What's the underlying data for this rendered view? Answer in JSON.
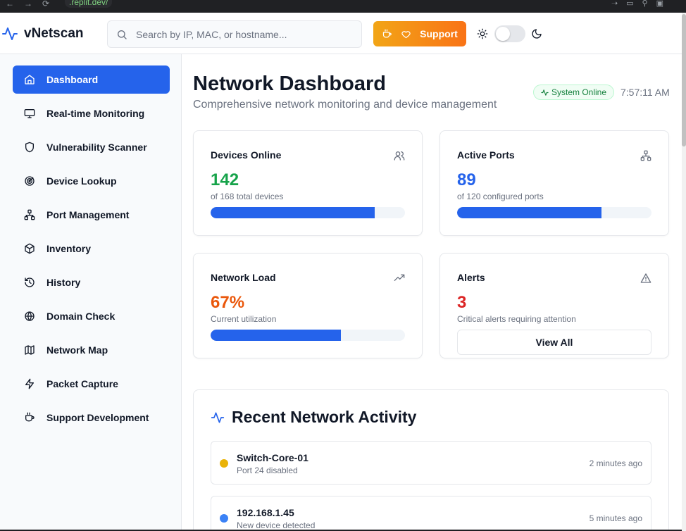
{
  "browser": {
    "url": ".replit.dev/"
  },
  "header": {
    "app_name": "vNetscan",
    "search_placeholder": "Search by IP, MAC, or hostname...",
    "support_label": "Support"
  },
  "sidebar": {
    "items": [
      {
        "label": "Dashboard",
        "icon": "home-icon",
        "active": true
      },
      {
        "label": "Real-time Monitoring",
        "icon": "monitor-icon"
      },
      {
        "label": "Vulnerability Scanner",
        "icon": "shield-icon"
      },
      {
        "label": "Device Lookup",
        "icon": "radar-icon"
      },
      {
        "label": "Port Management",
        "icon": "network-icon"
      },
      {
        "label": "Inventory",
        "icon": "package-icon"
      },
      {
        "label": "History",
        "icon": "history-icon"
      },
      {
        "label": "Domain Check",
        "icon": "globe-icon"
      },
      {
        "label": "Network Map",
        "icon": "map-icon"
      },
      {
        "label": "Packet Capture",
        "icon": "zap-icon"
      },
      {
        "label": "Support Development",
        "icon": "coffee-icon"
      }
    ]
  },
  "main": {
    "title": "Network Dashboard",
    "subtitle": "Comprehensive network monitoring and device management",
    "status": "System Online",
    "time": "7:57:11 AM"
  },
  "cards": {
    "devices": {
      "title": "Devices Online",
      "value": "142",
      "desc": "of 168 total devices",
      "progress": 0.845,
      "color": "#16a34a"
    },
    "ports": {
      "title": "Active Ports",
      "value": "89",
      "desc": "of 120 configured ports",
      "progress": 0.742,
      "color": "#2563eb"
    },
    "load": {
      "title": "Network Load",
      "value": "67%",
      "desc": "Current utilization",
      "progress": 0.67,
      "color": "#ea580c"
    },
    "alerts": {
      "title": "Alerts",
      "value": "3",
      "desc": "Critical alerts requiring attention",
      "button": "View All",
      "color": "#dc2626"
    }
  },
  "activity": {
    "title": "Recent Network Activity",
    "items": [
      {
        "name": "Switch-Core-01",
        "detail": "Port 24 disabled",
        "time": "2 minutes ago",
        "color": "#eab308"
      },
      {
        "name": "192.168.1.45",
        "detail": "New device detected",
        "time": "5 minutes ago",
        "color": "#3b82f6"
      }
    ]
  },
  "colors": {
    "accent": "#2563eb",
    "support_start": "#f2a516",
    "support_end": "#f97316"
  }
}
